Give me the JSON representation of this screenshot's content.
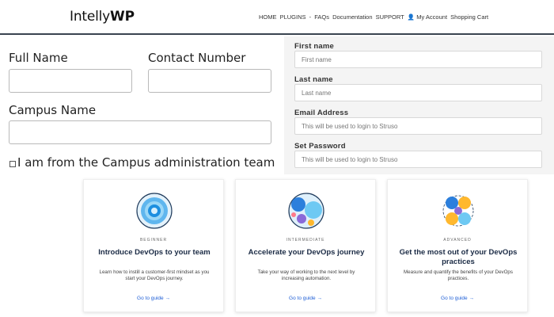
{
  "header": {
    "logo_plain": "Intelly",
    "logo_bold": "WP",
    "nav_items": [
      "HOME",
      "PLUGINS",
      "-",
      "FAQs",
      "Documentation",
      "SUPPORT",
      "👤 My Account",
      "Shopping Cart"
    ]
  },
  "left_form": {
    "full_name_label": "Full Name",
    "contact_label": "Contact Number",
    "campus_label": "Campus Name",
    "admin_checkbox_label": "I am from the Campus administration team"
  },
  "right_form": {
    "first_name_label": "First name",
    "first_name_placeholder": "First name",
    "last_name_label": "Last name",
    "last_name_placeholder": "Last name",
    "email_label": "Email Address",
    "email_placeholder": "This will be used to login to Struso",
    "password_label": "Set Password",
    "password_placeholder": "This will be used to login to Struso"
  },
  "cards": [
    {
      "level": "BEGINNER",
      "title": "Introduce DevOps to your team",
      "description": "Learn how to instill a customer-first mindset as you start your DevOps journey.",
      "link": "Go to guide →"
    },
    {
      "level": "INTERMEDIATE",
      "title": "Accelerate your DevOps journey",
      "description": "Take your way of working to the next level by increasing automation.",
      "link": "Go to guide →"
    },
    {
      "level": "ADVANCED",
      "title": "Get the most out of your DevOps practices",
      "description": "Measure and quantify the benefits of your DevOps practices.",
      "link": "Go to guide →"
    }
  ],
  "colors": {
    "header_border": "#3a4450",
    "card_title": "#1b2b45",
    "link": "#1f5fd6",
    "right_panel_bg": "#f4f4f4"
  }
}
